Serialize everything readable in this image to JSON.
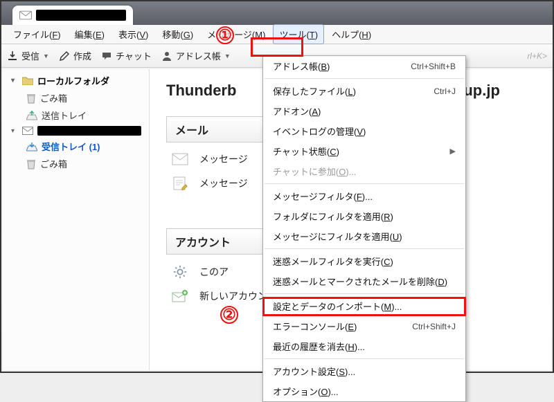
{
  "tab": {
    "account_redacted": true
  },
  "menubar": {
    "file": {
      "text": "ファイル(",
      "hot": "F",
      "tail": ")"
    },
    "edit": {
      "text": "編集(",
      "hot": "E",
      "tail": ")"
    },
    "view": {
      "text": "表示(",
      "hot": "V",
      "tail": ")"
    },
    "go": {
      "text": "移動(",
      "hot": "G",
      "tail": ")"
    },
    "message": {
      "text": "メッセージ(",
      "hot": "M",
      "tail": ")"
    },
    "tools": {
      "text": "ツール(",
      "hot": "T",
      "tail": ")"
    },
    "help": {
      "text": "ヘルプ(",
      "hot": "H",
      "tail": ")"
    }
  },
  "toolbar": {
    "receive": "受信",
    "compose": "作成",
    "chat": "チャット",
    "addressbook": "アドレス帳",
    "search_hint": "rl+K>"
  },
  "sidebar": {
    "local_folders": "ローカルフォルダ",
    "trash": "ごみ箱",
    "outbox": "送信トレイ",
    "inbox_unread": "受信トレイ (1)",
    "trash2": "ごみ箱"
  },
  "content": {
    "headline_left": "Thunderb",
    "headline_right": "roup.jp",
    "section_mail": "メール",
    "row_msg1": "メッセージ",
    "row_msg2": "メッセージ",
    "section_account": "アカウント",
    "row_this": "このア",
    "row_new": "新しいアカウントを作成する"
  },
  "menu_tools": {
    "addressbook": {
      "pre": "アドレス帳(",
      "hot": "B",
      "tail": ")",
      "shortcut": "Ctrl+Shift+B"
    },
    "saved_files": {
      "pre": "保存したファイル(",
      "hot": "L",
      "tail": ")",
      "shortcut": "Ctrl+J"
    },
    "addons": {
      "pre": "アドオン(",
      "hot": "A",
      "tail": ")"
    },
    "eventlog": {
      "pre": "イベントログの管理(",
      "hot": "V",
      "tail": ")"
    },
    "chat_state": {
      "pre": "チャット状態(",
      "hot": "C",
      "tail": ")",
      "submenu": true
    },
    "chat_join": {
      "pre": "チャットに参加(",
      "hot": "O",
      "tail": ")...",
      "disabled": true
    },
    "msg_filters": {
      "pre": "メッセージフィルタ(",
      "hot": "F",
      "tail": ")..."
    },
    "apply_folder": {
      "pre": "フォルダにフィルタを適用(",
      "hot": "R",
      "tail": ")"
    },
    "apply_msg": {
      "pre": "メッセージにフィルタを適用(",
      "hot": "U",
      "tail": ")"
    },
    "junk_run": {
      "pre": "迷惑メールフィルタを実行(",
      "hot": "C",
      "tail": ")"
    },
    "junk_del": {
      "pre": "迷惑メールとマークされたメールを削除(",
      "hot": "D",
      "tail": ")"
    },
    "import": {
      "pre": "設定とデータのインポート(",
      "hot": "M",
      "tail": ")..."
    },
    "err_console": {
      "pre": "エラーコンソール(",
      "hot": "E",
      "tail": ")",
      "shortcut": "Ctrl+Shift+J"
    },
    "clear_hist": {
      "pre": "最近の履歴を消去(",
      "hot": "H",
      "tail": ")..."
    },
    "acct_settings": {
      "pre": "アカウント設定(",
      "hot": "S",
      "tail": ")..."
    },
    "options": {
      "pre": "オプション(",
      "hot": "O",
      "tail": ")..."
    }
  },
  "callouts": {
    "one": "①",
    "two": "②"
  }
}
